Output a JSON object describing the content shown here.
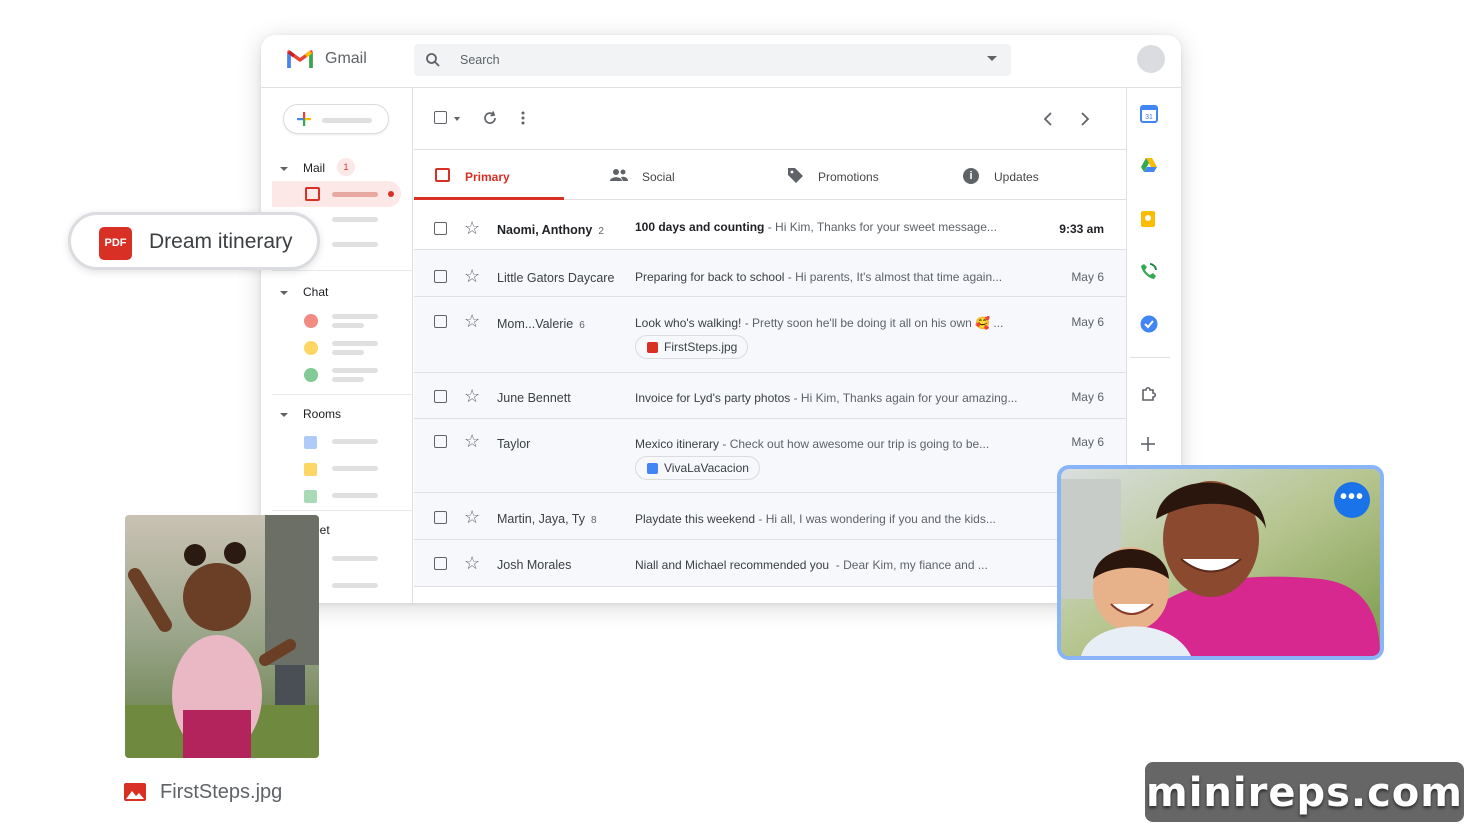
{
  "app": {
    "title": "Gmail"
  },
  "search": {
    "placeholder": "Search"
  },
  "sidebar": {
    "mail_label": "Mail",
    "mail_badge": "1",
    "chat_label": "Chat",
    "rooms_label": "Rooms",
    "meet_label": "Meet"
  },
  "tabs": [
    {
      "label": "Primary",
      "icon": "inbox-icon",
      "active": true
    },
    {
      "label": "Social",
      "icon": "people-icon"
    },
    {
      "label": "Promotions",
      "icon": "tag-icon"
    },
    {
      "label": "Updates",
      "icon": "info-icon"
    }
  ],
  "emails": [
    {
      "sender": "Naomi, Anthony",
      "count": "2",
      "subject": "100 days and counting",
      "snippet": " - Hi Kim, Thanks for your sweet message...",
      "date": "9:33 am",
      "unread": true
    },
    {
      "sender": "Little Gators Daycare",
      "count": "",
      "subject": "Preparing for back to school",
      "snippet": " - Hi parents, It's almost that time again...",
      "date": "May 6"
    },
    {
      "sender": "Mom...Valerie",
      "count": "6",
      "subject": "Look who's walking!",
      "snippet": " - Pretty soon he'll be doing it all on his own 🥰 ...",
      "date": "May 6",
      "attachment": "FirstSteps.jpg"
    },
    {
      "sender": "June Bennett",
      "count": "",
      "subject": "Invoice for Lyd's party photos",
      "snippet": " - Hi Kim, Thanks again for your amazing...",
      "date": "May 6"
    },
    {
      "sender": "Taylor",
      "count": "",
      "subject": "Mexico itinerary",
      "snippet": " - Check out how awesome our trip is going to be...",
      "date": "May 6",
      "attachment": "VivaLaVacacion"
    },
    {
      "sender": "Martin, Jaya, Ty",
      "count": "8",
      "subject": "Playdate this weekend",
      "snippet": " - Hi all, I was wondering if you and the kids...",
      "date": ""
    },
    {
      "sender": "Josh Morales",
      "count": "",
      "subject": "Niall and Michael recommended you",
      "snippet": "  - Dear Kim, my fiance and ...",
      "date": ""
    }
  ],
  "overlay": {
    "pdf_badge": "PDF",
    "pdf_name": "Dream itinerary",
    "photo_caption": "FirstSteps.jpg"
  },
  "watermark": "minireps.com",
  "colors": {
    "accent": "#d93025",
    "blue": "#1a73e8",
    "video_border": "#8ab4f8"
  }
}
